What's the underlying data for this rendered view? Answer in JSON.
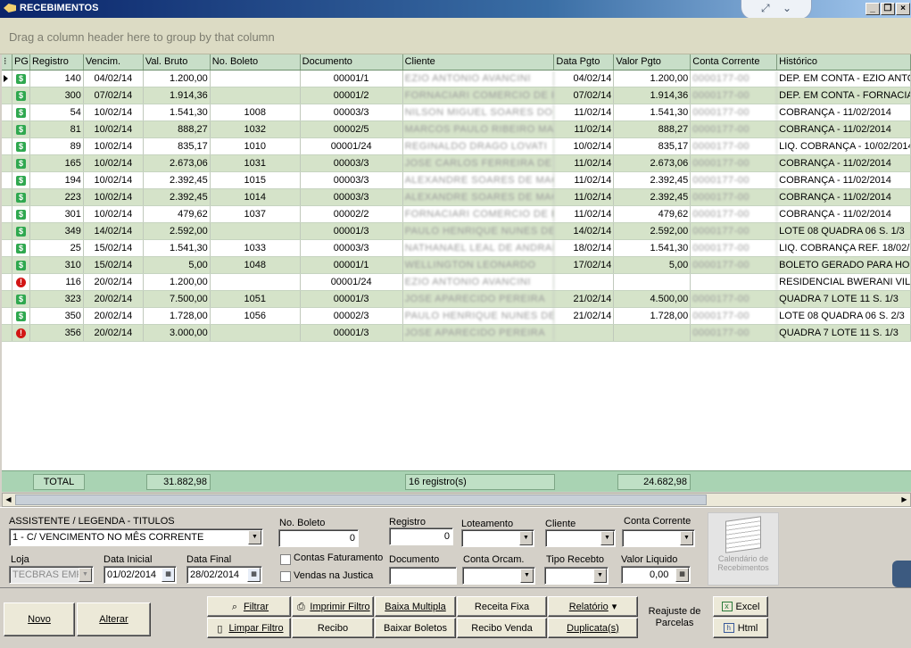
{
  "window": {
    "title": "RECEBIMENTOS"
  },
  "group_hint": "Drag a column header here to group by that column",
  "columns": [
    "PG",
    "Registro",
    "Vencim.",
    "Val. Bruto",
    "No. Boleto",
    "Documento",
    "Cliente",
    "Data Pgto",
    "Valor Pgto",
    "Conta Corrente",
    "Histórico"
  ],
  "rows": [
    {
      "pg": "paid",
      "registro": "140",
      "vencim": "04/02/14",
      "bruto": "1.200,00",
      "boleto": "",
      "doc": "00001/1",
      "cliente": "EZIO ANTONIO AVANCINI",
      "dpgto": "04/02/14",
      "vpgto": "1.200,00",
      "conta": "0000177-00",
      "hist": "DEP. EM CONTA - EZIO ANTO"
    },
    {
      "pg": "paid",
      "registro": "300",
      "vencim": "07/02/14",
      "bruto": "1.914,36",
      "boleto": "",
      "doc": "00001/2",
      "cliente": "FORNACIARI COMERCIO DE PRODUTOS",
      "dpgto": "07/02/14",
      "vpgto": "1.914,36",
      "conta": "0000177-00",
      "hist": "DEP. EM CONTA - FORNACIA"
    },
    {
      "pg": "paid",
      "registro": "54",
      "vencim": "10/02/14",
      "bruto": "1.541,30",
      "boleto": "1008",
      "doc": "00003/3",
      "cliente": "NILSON MIGUEL SOARES DOS SANTOS",
      "dpgto": "11/02/14",
      "vpgto": "1.541,30",
      "conta": "0000177-00",
      "hist": "COBRANÇA - 11/02/2014"
    },
    {
      "pg": "paid",
      "registro": "81",
      "vencim": "10/02/14",
      "bruto": "888,27",
      "boleto": "1032",
      "doc": "00002/5",
      "cliente": "MARCOS PAULO RIBEIRO MACHADO",
      "dpgto": "11/02/14",
      "vpgto": "888,27",
      "conta": "0000177-00",
      "hist": "COBRANÇA - 11/02/2014"
    },
    {
      "pg": "paid",
      "registro": "89",
      "vencim": "10/02/14",
      "bruto": "835,17",
      "boleto": "1010",
      "doc": "00001/24",
      "cliente": "REGINALDO DRAGO LOVATI",
      "dpgto": "10/02/14",
      "vpgto": "835,17",
      "conta": "0000177-00",
      "hist": "LIQ. COBRANÇA - 10/02/2014"
    },
    {
      "pg": "paid",
      "registro": "165",
      "vencim": "10/02/14",
      "bruto": "2.673,06",
      "boleto": "1031",
      "doc": "00003/3",
      "cliente": "JOSE CARLOS FERREIRA DE SOUZA",
      "dpgto": "11/02/14",
      "vpgto": "2.673,06",
      "conta": "0000177-00",
      "hist": "COBRANÇA - 11/02/2014"
    },
    {
      "pg": "paid",
      "registro": "194",
      "vencim": "10/02/14",
      "bruto": "2.392,45",
      "boleto": "1015",
      "doc": "00003/3",
      "cliente": "ALEXANDRE SOARES DE MACEDO",
      "dpgto": "11/02/14",
      "vpgto": "2.392,45",
      "conta": "0000177-00",
      "hist": "COBRANÇA - 11/02/2014"
    },
    {
      "pg": "paid",
      "registro": "223",
      "vencim": "10/02/14",
      "bruto": "2.392,45",
      "boleto": "1014",
      "doc": "00003/3",
      "cliente": "ALEXANDRE SOARES DE MACEDO",
      "dpgto": "11/02/14",
      "vpgto": "2.392,45",
      "conta": "0000177-00",
      "hist": "COBRANÇA - 11/02/2014"
    },
    {
      "pg": "paid",
      "registro": "301",
      "vencim": "10/02/14",
      "bruto": "479,62",
      "boleto": "1037",
      "doc": "00002/2",
      "cliente": "FORNACIARI COMERCIO DE PRODUTOS",
      "dpgto": "11/02/14",
      "vpgto": "479,62",
      "conta": "0000177-00",
      "hist": "COBRANÇA - 11/02/2014"
    },
    {
      "pg": "paid",
      "registro": "349",
      "vencim": "14/02/14",
      "bruto": "2.592,00",
      "boleto": "",
      "doc": "00001/3",
      "cliente": "PAULO HENRIQUE NUNES DE ALMEIDA",
      "dpgto": "14/02/14",
      "vpgto": "2.592,00",
      "conta": "0000177-00",
      "hist": "LOTE 08 QUADRA 06 S. 1/3"
    },
    {
      "pg": "paid",
      "registro": "25",
      "vencim": "15/02/14",
      "bruto": "1.541,30",
      "boleto": "1033",
      "doc": "00003/3",
      "cliente": "NATHANAEL LEAL DE ANDRADE",
      "dpgto": "18/02/14",
      "vpgto": "1.541,30",
      "conta": "0000177-00",
      "hist": "LIQ. COBRANÇA REF. 18/02/"
    },
    {
      "pg": "paid",
      "registro": "310",
      "vencim": "15/02/14",
      "bruto": "5,00",
      "boleto": "1048",
      "doc": "00001/1",
      "cliente": "WELLINGTON LEONARDO",
      "dpgto": "17/02/14",
      "vpgto": "5,00",
      "conta": "0000177-00",
      "hist": "BOLETO GERADO PARA HON"
    },
    {
      "pg": "open",
      "registro": "116",
      "vencim": "20/02/14",
      "bruto": "1.200,00",
      "boleto": "",
      "doc": "00001/24",
      "cliente": "EZIO ANTONIO AVANCINI",
      "dpgto": "",
      "vpgto": "",
      "conta": "",
      "hist": "RESIDENCIAL BWERANI VILL"
    },
    {
      "pg": "paid",
      "registro": "323",
      "vencim": "20/02/14",
      "bruto": "7.500,00",
      "boleto": "1051",
      "doc": "00001/3",
      "cliente": "JOSE APARECIDO PEREIRA",
      "dpgto": "21/02/14",
      "vpgto": "4.500,00",
      "conta": "0000177-00",
      "hist": "QUADRA 7 LOTE 11 S. 1/3"
    },
    {
      "pg": "paid",
      "registro": "350",
      "vencim": "20/02/14",
      "bruto": "1.728,00",
      "boleto": "1056",
      "doc": "00002/3",
      "cliente": "PAULO HENRIQUE NUNES DE ALMEIDA",
      "dpgto": "21/02/14",
      "vpgto": "1.728,00",
      "conta": "0000177-00",
      "hist": "LOTE 08 QUADRA 06 S. 2/3"
    },
    {
      "pg": "open",
      "registro": "356",
      "vencim": "20/02/14",
      "bruto": "3.000,00",
      "boleto": "",
      "doc": "00001/3",
      "cliente": "JOSE APARECIDO PEREIRA",
      "dpgto": "",
      "vpgto": "",
      "conta": "0000177-00",
      "hist": "QUADRA 7 LOTE 11 S. 1/3"
    }
  ],
  "totals": {
    "label": "TOTAL",
    "bruto": "31.882,98",
    "count": "16 registro(s)",
    "pgto": "24.682,98"
  },
  "filters": {
    "assistente_label": "ASSISTENTE / LEGENDA  - TITULOS",
    "assistente_value": "1 - C/ VENCIMENTO NO MÊS CORRENTE",
    "boleto_label": "No. Boleto",
    "boleto_value": "0",
    "registro_label": "Registro",
    "registro_value": "0",
    "loteamento_label": "Loteamento",
    "cliente_label": "Cliente",
    "conta_label": "Conta Corrente",
    "loja_label": "Loja",
    "loja_value": "TECBRAS EMP",
    "data_inicial_label": "Data Inicial",
    "data_inicial_value": "01/02/2014",
    "data_final_label": "Data Final",
    "data_final_value": "28/02/2014",
    "contas_fat_label": "Contas Faturamento",
    "vendas_justica_label": "Vendas na Justica",
    "documento_label": "Documento",
    "conta_orcam_label": "Conta Orcam.",
    "tipo_recebto_label": "Tipo Recebto",
    "valor_liquido_label": "Valor Liquido",
    "valor_liquido_value": "0,00",
    "calendar_label": "Calendário de Recebimentos"
  },
  "buttons": {
    "novo": "Novo",
    "alterar": "Alterar",
    "filtrar": "Filtrar",
    "limpar": "Limpar Filtro",
    "imprimir": "Imprimir Filtro",
    "recibo": "Recibo",
    "baixa_multipla": "Baixa Multipla",
    "baixar_boletos": "Baixar Boletos",
    "receita_fixa": "Receita Fixa",
    "recibo_venda": "Recibo Venda",
    "relatorio": "Relatório",
    "duplicatas": "Duplicata(s)",
    "reajuste": "Reajuste de Parcelas",
    "excel": "Excel",
    "html": "Html"
  },
  "colors": {
    "title_start": "#0a246a",
    "row_alt": "#d5e3c9",
    "paid": "#2fa84f",
    "open": "#d21515",
    "total_bar": "#a9d3b3"
  }
}
